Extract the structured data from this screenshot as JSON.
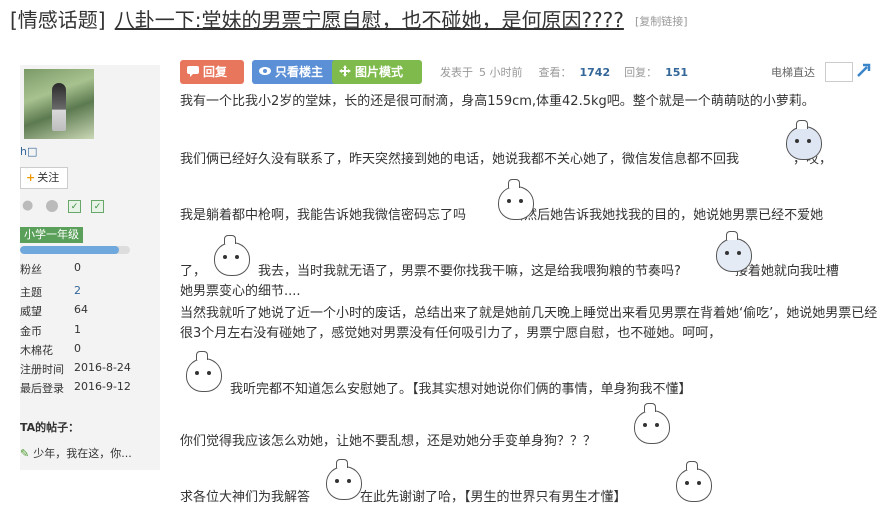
{
  "thread": {
    "category": "[情感话题]",
    "title": "八卦一下:堂妹的男票宁愿自慰，也不碰她，是何原因????",
    "copy_link": "[复制链接]"
  },
  "author": {
    "name": "h□",
    "follow_label": "关注",
    "level": "小学一年级",
    "level_progress_pct": 90,
    "stats": [
      {
        "key": "粉丝",
        "value": "0",
        "link": false
      },
      {
        "key": "主题",
        "value": "2",
        "link": true
      },
      {
        "key": "威望",
        "value": "64",
        "link": false
      },
      {
        "key": "金币",
        "value": "1",
        "link": false
      },
      {
        "key": "木棉花",
        "value": "0",
        "link": false
      },
      {
        "key": "注册时间",
        "value": "2016-8-24",
        "link": false
      },
      {
        "key": "最后登录",
        "value": "2016-9-12",
        "link": false
      }
    ],
    "ta_posts_label": "TA的帖子：",
    "ta_posts_item": "少年，我在这，你..."
  },
  "toolbar": {
    "reply_label": "回复",
    "owner_only_label": "只看楼主",
    "image_mode_label": "图片模式",
    "posted_label": "发表于",
    "posted_time": "5 小时前",
    "views_label": "查看：",
    "views": "1742",
    "replies_label": "回复：",
    "replies": "151",
    "elevator_label": "电梯直达"
  },
  "post": {
    "p1": "我有一个比我小2岁的堂妹，长的还是很可耐滴，身高159cm,体重42.5kg吧。整个就是一个萌萌哒的小萝莉。",
    "p2a": "我们俩已经好久没有联系了，昨天突然接到她的电话，她说我都不关心她了，微信发信息都不回我",
    "p2b": "，哎，",
    "p3a": "我是躺着都中枪啊，我能告诉她我微信密码忘了吗",
    "p3b": ",然后她告诉我她找我的目的，她说她男票已经不爱她",
    "p4a": "了，",
    "p4b": "我去，当时我就无语了，男票不要你找我干嘛，这是给我喂狗粮的节奏吗?",
    "p4c": "接着她就向我吐槽",
    "p4d": "她男票变心的细节....",
    "p5": "当然我就听了她说了近一个小时的废话，总结出来了就是她前几天晚上睡觉出来看见男票在背着她‘偷吃’，她说她男票已经很3个月左右没有碰她了，感觉她对男票没有任何吸引力了，男票宁愿自慰，也不碰她。呵呵，",
    "p6": "我听完都不知道怎么安慰她了。【我其实想对她说你们俩的事情，单身狗我不懂】",
    "p7": "你们觉得我应该怎么劝她，让她不要乱想，还是劝她分手变单身狗？？？",
    "p8a": "求各位大神们为我解答",
    "p8b": "在此先谢谢了哈，【男生的世界只有男生才懂】"
  },
  "colors": {
    "reply_btn": "#e8765d",
    "owner_btn": "#5b8fd6",
    "image_btn": "#7fbb4c",
    "level_badge": "#5aa05a",
    "link": "#336699"
  }
}
